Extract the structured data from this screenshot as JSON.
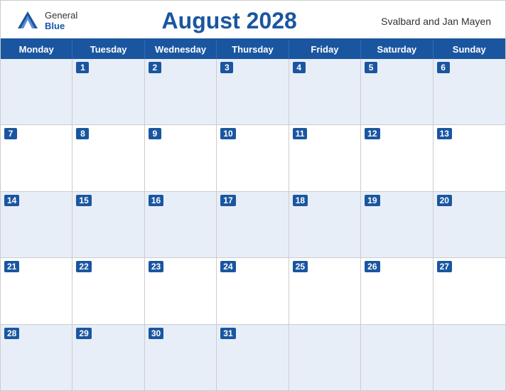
{
  "header": {
    "logo_general": "General",
    "logo_blue": "Blue",
    "month_title": "August 2028",
    "region": "Svalbard and Jan Mayen"
  },
  "day_headers": [
    "Monday",
    "Tuesday",
    "Wednesday",
    "Thursday",
    "Friday",
    "Saturday",
    "Sunday"
  ],
  "weeks": [
    [
      null,
      1,
      2,
      3,
      4,
      5,
      6
    ],
    [
      7,
      8,
      9,
      10,
      11,
      12,
      13
    ],
    [
      14,
      15,
      16,
      17,
      18,
      19,
      20
    ],
    [
      21,
      22,
      23,
      24,
      25,
      26,
      27
    ],
    [
      28,
      29,
      30,
      31,
      null,
      null,
      null
    ]
  ]
}
